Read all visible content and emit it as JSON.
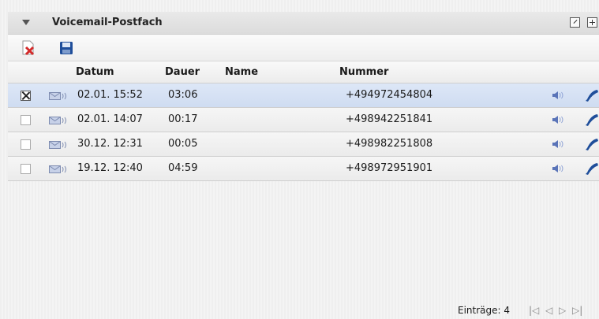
{
  "panel": {
    "title": "Voicemail-Postfach"
  },
  "icons": {
    "collapse": "triangle-down-icon",
    "expand": "expand-window-icon",
    "add": "plus-icon",
    "delete": "delete-document-icon",
    "save": "floppy-disk-icon",
    "message": "envelope-sound-icon",
    "play": "speaker-icon",
    "call": "phone-handset-icon"
  },
  "columns": {
    "datum": "Datum",
    "dauer": "Dauer",
    "name": "Name",
    "nummer": "Nummer"
  },
  "rows": [
    {
      "checked": true,
      "datum": "02.01. 15:52",
      "dauer": "03:06",
      "name": "",
      "nummer": "+494972454804"
    },
    {
      "checked": false,
      "datum": "02.01. 14:07",
      "dauer": "00:17",
      "name": "",
      "nummer": "+498942251841"
    },
    {
      "checked": false,
      "datum": "30.12. 12:31",
      "dauer": "00:05",
      "name": "",
      "nummer": "+498982251808"
    },
    {
      "checked": false,
      "datum": "19.12. 12:40",
      "dauer": "04:59",
      "name": "",
      "nummer": "+498972951901"
    }
  ],
  "footer": {
    "entries_label": "Einträge: 4"
  },
  "colors": {
    "selected_row": "#d5e0f4",
    "accent_blue": "#1f4e9a",
    "delete_red": "#d42a2a"
  }
}
